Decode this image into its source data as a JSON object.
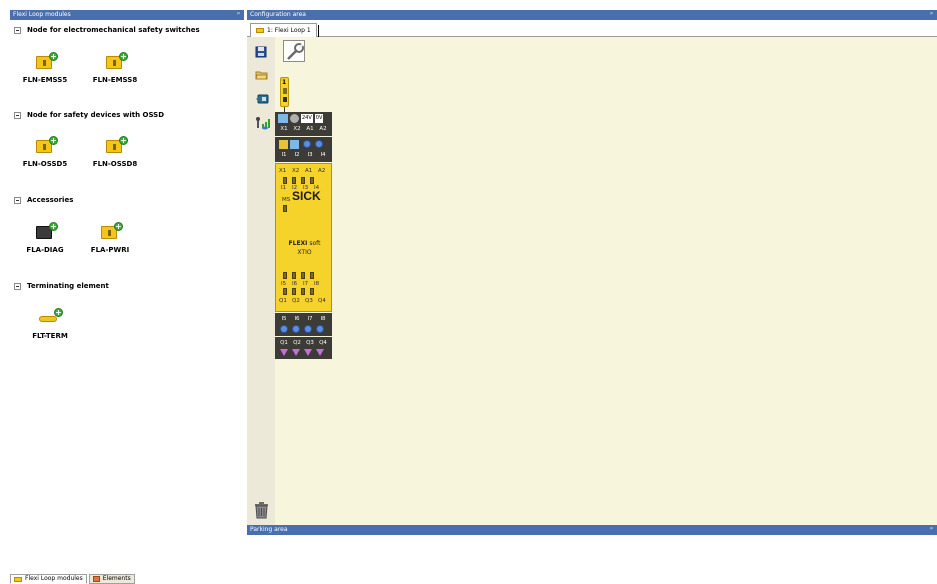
{
  "left_panel": {
    "title": "Flexi Loop modules",
    "pin": "ᵖ",
    "groups": [
      {
        "label": "Node for electromechanical safety switches",
        "modules": [
          "FLN-EMSS5",
          "FLN-EMSS8"
        ]
      },
      {
        "label": "Node for safety devices with OSSD",
        "modules": [
          "FLN-OSSD5",
          "FLN-OSSD8"
        ]
      },
      {
        "label": "Accessories",
        "modules": [
          "FLA-DIAG",
          "FLA-PWRI"
        ]
      },
      {
        "label": "Terminating element",
        "modules": [
          "FLT-TERM"
        ]
      }
    ],
    "bottom_tabs": [
      {
        "label": "Flexi Loop modules",
        "icon": "flexi-loop-icon",
        "active": true
      },
      {
        "label": "Elements",
        "icon": "elements-icon",
        "active": false
      }
    ]
  },
  "config_area": {
    "title": "Configuration area",
    "pin": "ᵖ",
    "tab_label": "1: Flexi Loop 1",
    "toolbar": [
      "save-icon",
      "open-folder-icon",
      "import-icon",
      "signal-icon",
      "trash-icon"
    ],
    "module": {
      "top_terminals": [
        "X1",
        "X2",
        "A1",
        "A2"
      ],
      "top_header": [
        "24V",
        "0V"
      ],
      "inputs_top": [
        "I1",
        "I2",
        "I3",
        "I4"
      ],
      "led_labels_top": [
        "X1",
        "X2",
        "A1",
        "A2"
      ],
      "led_labels_inputs": [
        "I1",
        "I2",
        "I3",
        "I4"
      ],
      "ms_label": "MS",
      "brand": "SICK",
      "product_line1_bold": "FLEXI",
      "product_line1_rest": " soft",
      "product_line2": "XTIO",
      "led_labels_i5": [
        "I5",
        "I6",
        "I7",
        "I8"
      ],
      "led_labels_q": [
        "Q1",
        "Q2",
        "Q3",
        "Q4"
      ],
      "inputs_bottom": [
        "I5",
        "I6",
        "I7",
        "I8"
      ],
      "outputs_bottom": [
        "Q1",
        "Q2",
        "Q3",
        "Q4"
      ],
      "connector_label": "1"
    }
  },
  "parking_area": {
    "title": "Parking area",
    "pin": "ᵖ"
  },
  "colors": {
    "title_bar": "#4a6fae",
    "canvas": "#f8f5dd",
    "module_yellow": "#f6d32a",
    "module_dark": "#3d3b36"
  }
}
